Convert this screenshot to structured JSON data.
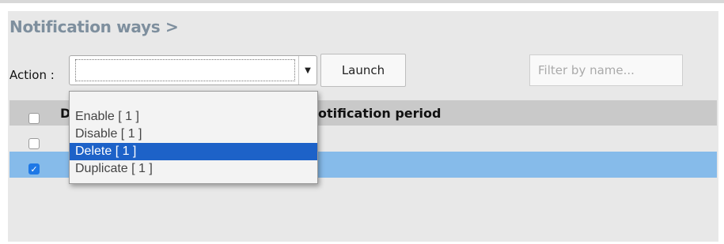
{
  "page": {
    "title": "Notification ways >"
  },
  "toolbar": {
    "action_label": "Action :",
    "action_value": "",
    "launch_label": "Launch",
    "filter_placeholder": "Filter by name..."
  },
  "table": {
    "header_col1": "D",
    "header_col2": "otification period",
    "rows": [
      {
        "checked": false,
        "selected": false
      },
      {
        "checked": true,
        "selected": true
      }
    ]
  },
  "action_menu": {
    "options": [
      "Enable [ 1 ]",
      "Disable [ 1 ]",
      "Delete [ 1 ]",
      "Duplicate [ 1 ]"
    ],
    "selected_index": 2
  },
  "colors": {
    "title": "#7e8f9e",
    "selected_row": "#86bbea",
    "selected_option": "#1d62c8",
    "checkbox_checked": "#1e78e6"
  },
  "icons": {
    "select_arrow": "triangle-down-icon",
    "checkmark": "checkmark-icon"
  }
}
